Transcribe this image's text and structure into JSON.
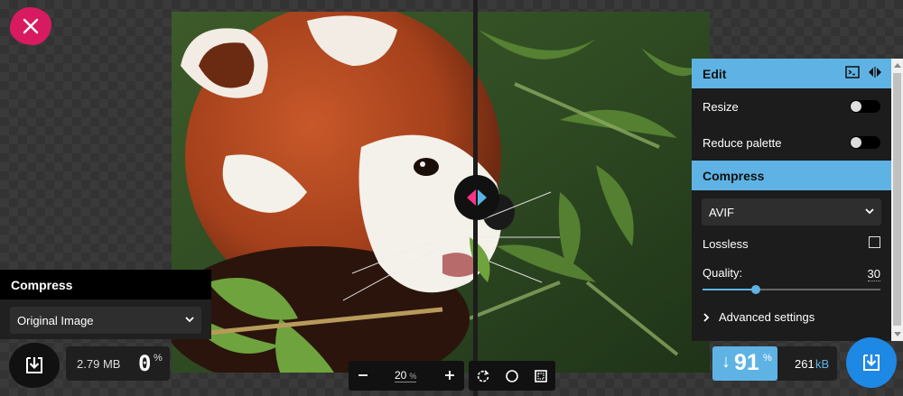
{
  "left": {
    "close_icon": "close-icon",
    "options_title": "Compress",
    "method_selected": "Original Image",
    "file_size_value": "2.79",
    "file_size_unit": "MB",
    "reduction_value": "0",
    "reduction_unit": "%"
  },
  "zoom": {
    "value": "20",
    "unit": "%"
  },
  "right": {
    "edit_title": "Edit",
    "resize_label": "Resize",
    "resize_enabled": false,
    "reduce_palette_label": "Reduce palette",
    "reduce_palette_enabled": false,
    "compress_title": "Compress",
    "codec_selected": "AVIF",
    "lossless_label": "Lossless",
    "lossless_checked": false,
    "quality_label": "Quality:",
    "quality_value": "30",
    "quality_fraction": 0.3,
    "advanced_label": "Advanced settings",
    "reduction_arrow": "↓",
    "reduction_value": "91",
    "reduction_unit": "%",
    "file_size_value": "261",
    "file_size_unit": "kB"
  },
  "colors": {
    "accent_blue": "#5fb3e4",
    "accent_pink": "#d81b60",
    "download_blue": "#1e88e5"
  }
}
